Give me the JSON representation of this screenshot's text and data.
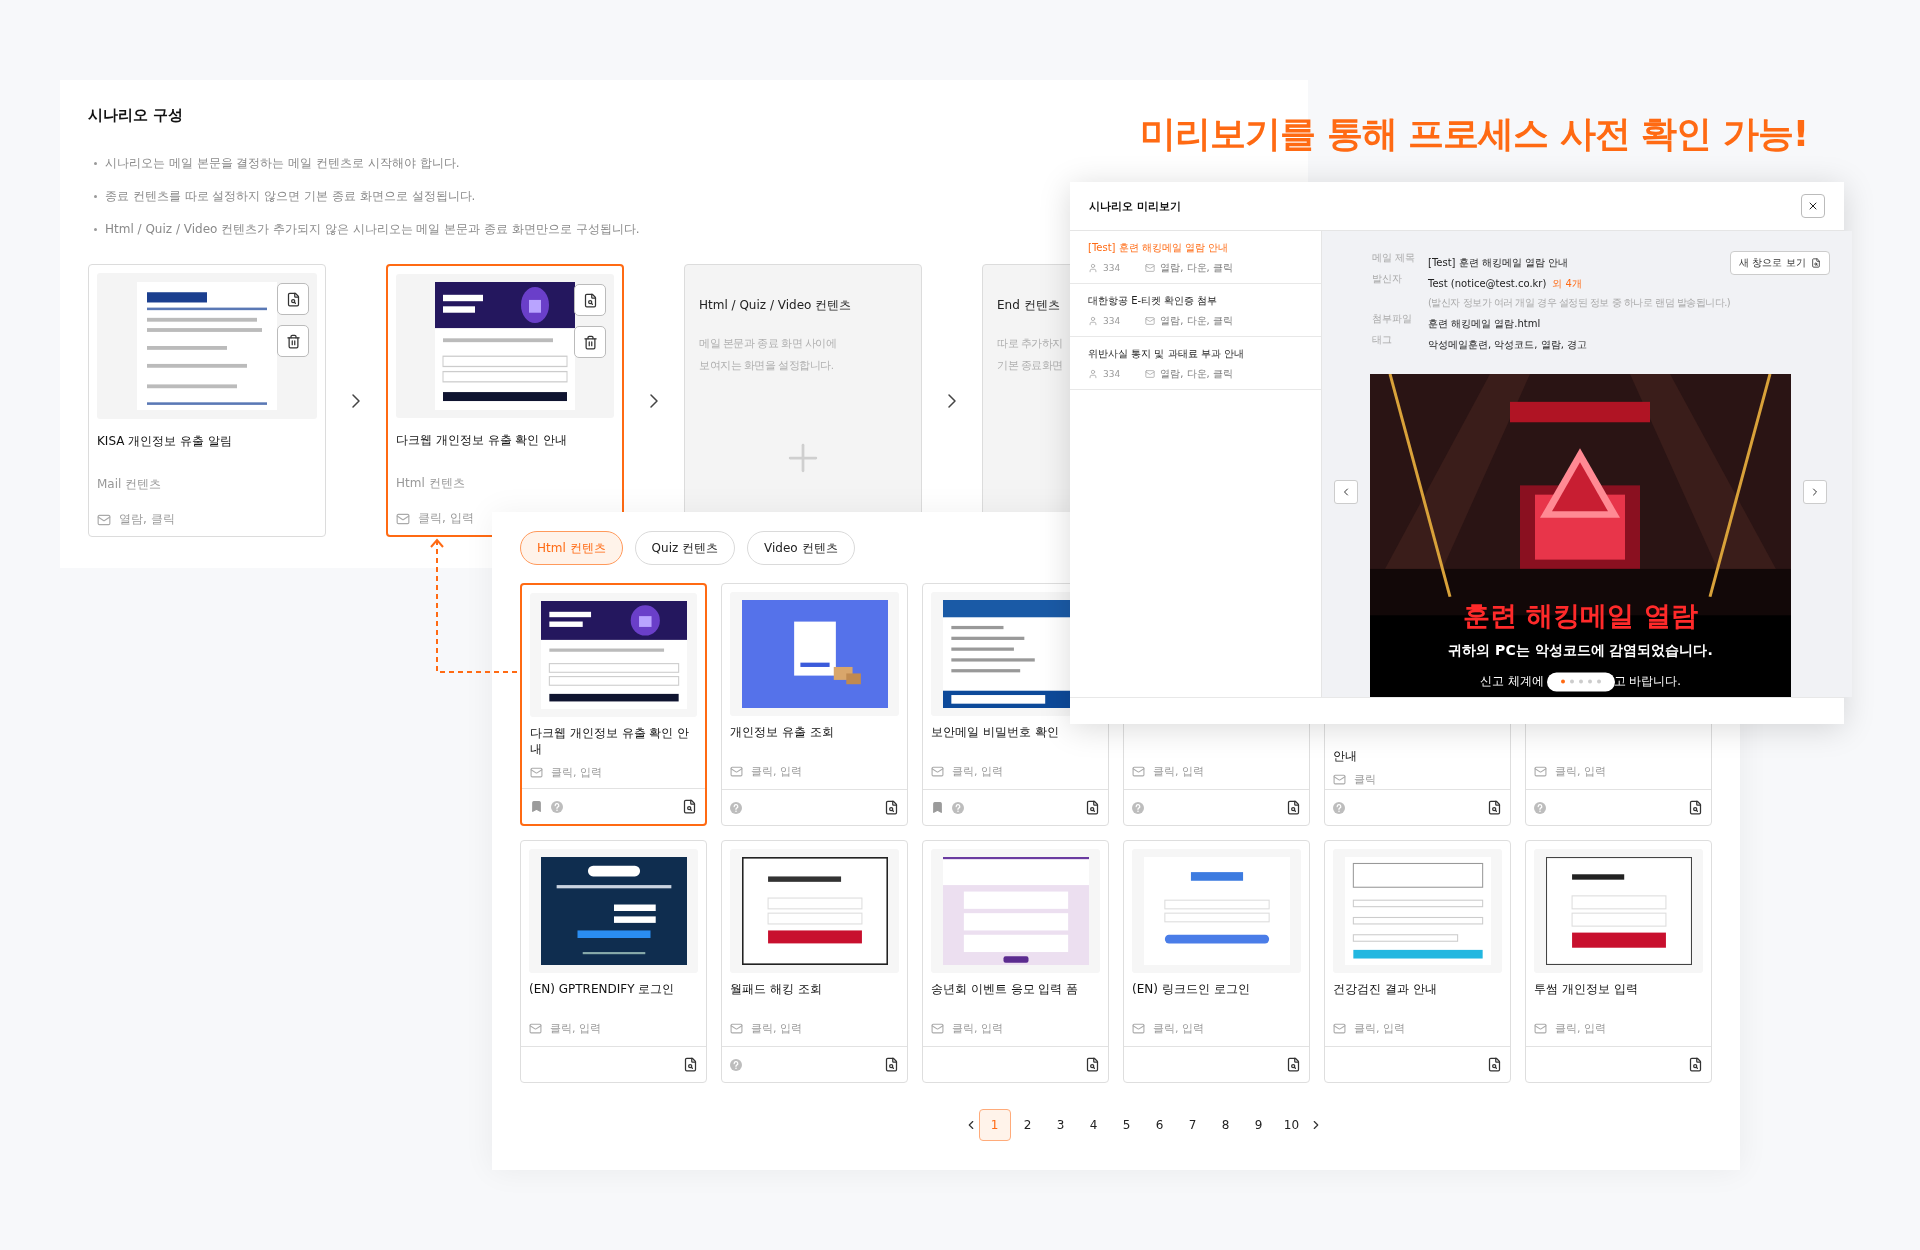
{
  "headline": "미리보기를 통해 프로세스 사전 확인 가능!",
  "scenario": {
    "title": "시나리오 구성",
    "notes": [
      "시나리오는 메일 본문을 결정하는 메일 컨텐츠로 시작해야 합니다.",
      "종료 컨텐츠를 따로 설정하지 않으면 기본 종료 화면으로 설정됩니다.",
      "Html / Quiz / Video 컨텐츠가 추가되지 않은 시나리오는 메일 본문과 종료 화면만으로 구성됩니다."
    ],
    "steps": [
      {
        "kind": "content",
        "title": "KISA 개인정보 유출 알림",
        "type": "Mail 컨텐츠",
        "actions": "열람, 클릭",
        "selected": false
      },
      {
        "kind": "content",
        "title": "다크웹 개인정보 유출 확인 안내",
        "type": "Html 컨텐츠",
        "actions": "클릭, 입력",
        "selected": true
      },
      {
        "kind": "empty",
        "title": "Html / Quiz / Video 컨텐츠",
        "lines": [
          "메일 본문과 종료 화면 사이에",
          "보여지는 화면을 설정합니다."
        ],
        "add_icon": true
      },
      {
        "kind": "empty",
        "title": "End 컨텐츠",
        "lines": [
          "따로 추가하지",
          "기본 종료화면"
        ]
      }
    ]
  },
  "picker": {
    "tabs": [
      {
        "label": "Html 컨텐츠",
        "selected": true
      },
      {
        "label": "Quiz 컨텐츠",
        "selected": false
      },
      {
        "label": "Video 컨텐츠",
        "selected": false
      }
    ],
    "cards": [
      {
        "title": "다크웹 개인정보 유출 확인 안내",
        "actions": "클릭, 입력",
        "selected": true,
        "bookmark": true,
        "help": true
      },
      {
        "title": "개인정보 유출 조회",
        "actions": "클릭, 입력",
        "selected": false,
        "bookmark": false,
        "help": true
      },
      {
        "title": "보안메일 비밀번호 확인",
        "actions": "클릭, 입력",
        "selected": false,
        "bookmark": true,
        "help": true
      },
      {
        "actions": "클릭, 입력",
        "selected": false,
        "bookmark": false,
        "help": true
      },
      {
        "title_tail": "안내",
        "actions": "클릭",
        "selected": false,
        "bookmark": false,
        "help": true
      },
      {
        "actions": "클릭, 입력",
        "selected": false,
        "bookmark": false,
        "help": true
      },
      {
        "title": "(EN) GPTRENDIFY 로그인",
        "actions": "클릭, 입력",
        "selected": false,
        "bookmark": false,
        "help": false
      },
      {
        "title": "월패드 해킹 조회",
        "actions": "클릭, 입력",
        "selected": false,
        "bookmark": false,
        "help": true
      },
      {
        "title": "송년회 이벤트 응모 입력 폼",
        "actions": "클릭, 입력",
        "selected": false,
        "bookmark": false,
        "help": false
      },
      {
        "title": "(EN) 링크드인 로그인",
        "actions": "클릭, 입력",
        "selected": false,
        "bookmark": false,
        "help": false
      },
      {
        "title": "건강검진 결과 안내",
        "actions": "클릭, 입력",
        "selected": false,
        "bookmark": false,
        "help": false
      },
      {
        "title": "투썸 개인정보 입력",
        "actions": "클릭, 입력",
        "selected": false,
        "bookmark": false,
        "help": false
      }
    ],
    "pages": [
      {
        "label": "1",
        "selected": true
      },
      {
        "label": "2",
        "selected": false
      },
      {
        "label": "3",
        "selected": false
      },
      {
        "label": "4",
        "selected": false
      },
      {
        "label": "5",
        "selected": false
      },
      {
        "label": "6",
        "selected": false
      },
      {
        "label": "7",
        "selected": false
      },
      {
        "label": "8",
        "selected": false
      },
      {
        "label": "9",
        "selected": false
      },
      {
        "label": "10",
        "selected": false
      }
    ]
  },
  "preview": {
    "title": "시나리오 미리보기",
    "list": [
      {
        "title": "[Test] 훈련 해킹메일 열람 안내",
        "recipients": "334",
        "actions": "열람, 다운, 클릭",
        "selected": true
      },
      {
        "title": "대한항공 E-티켓 확인증 첨부",
        "recipients": "334",
        "actions": "열람, 다운, 클릭",
        "selected": false
      },
      {
        "title": "위반사실 통지 및 과태료 부과 안내",
        "recipients": "334",
        "actions": "열람, 다운, 클릭",
        "selected": false
      }
    ],
    "fields": [
      {
        "label": "메일 제목",
        "value": "[Test] 훈련 해킹메일 열람 안내"
      },
      {
        "label": "발신자",
        "value": "Test (notice@test.co.kr)",
        "extra": "외 4개",
        "note": "(발신자 정보가 여러 개일 경우 설정된 정보 중 하나로 랜덤 발송됩니다.)"
      },
      {
        "label": "첨부파일",
        "value": "훈련 해킹메일 열람.html"
      },
      {
        "label": "태그",
        "value": "악성메일훈련, 악성코드, 열람, 경고"
      }
    ],
    "open_button": "새 창으로 보기",
    "email": {
      "headline": "훈련 해킹메일 열람",
      "message": "귀하의 PC는 악성코드에 감염되었습니다.",
      "footer_start": "신고 체계에",
      "footer_end": "고 바랍니다."
    },
    "slides": [
      {
        "selected": true
      },
      {
        "selected": false
      },
      {
        "selected": false
      },
      {
        "selected": false
      },
      {
        "selected": false
      }
    ]
  }
}
